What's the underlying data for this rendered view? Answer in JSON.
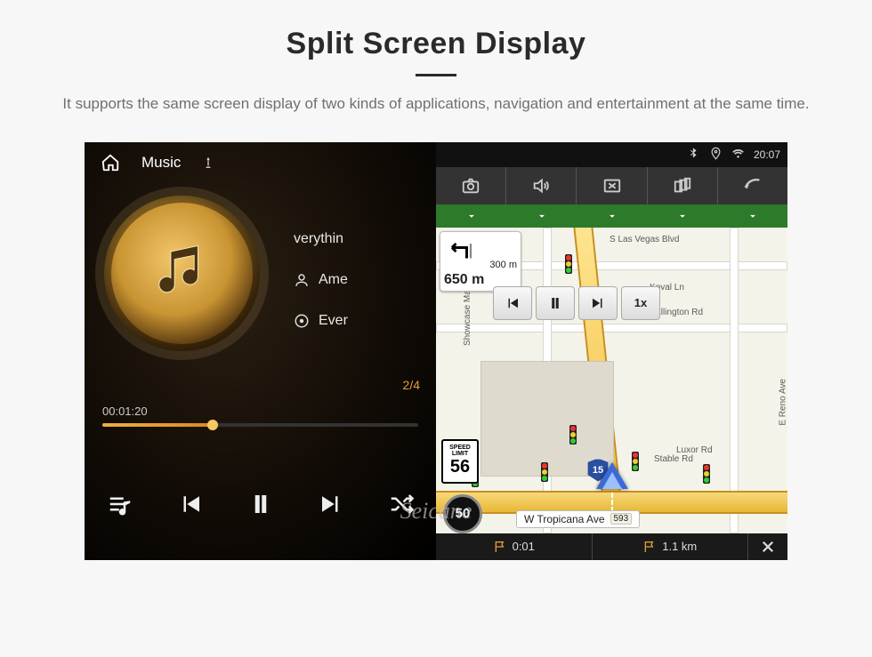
{
  "hero": {
    "title": "Split Screen Display",
    "subtitle": "It supports the same screen display of two kinds of applications, navigation and entertainment at the same time."
  },
  "watermark": "Seicane",
  "music": {
    "app_label": "Music",
    "rows": {
      "song": "verythin",
      "artist": "Ame",
      "album": "Ever"
    },
    "track_index": "2/4",
    "elapsed": "00:01:20"
  },
  "status": {
    "time": "20:07"
  },
  "nav": {
    "green_arrows_count": 5,
    "turn": {
      "dist1": "300 m",
      "dist2": "650 m"
    },
    "sim": {
      "speed_label": "1x"
    },
    "speed_limit": {
      "label_top": "SPEED",
      "label_bottom": "LIMIT",
      "value": "56"
    },
    "current_speed": "50",
    "route_shield": "15",
    "streets": {
      "s_las_vegas": "S Las Vegas Blvd",
      "koval": "Koval Ln",
      "duke": "Duke Ellington Rd",
      "showcase": "Showcase Mall",
      "luxor": "Luxor Rd",
      "stable": "Stable Rd",
      "reno": "E Reno Ave"
    },
    "destination": {
      "name": "W Tropicana Ave",
      "tag": "593"
    },
    "bottom": {
      "time_left": "0:01",
      "distance": "1.1 km"
    }
  }
}
